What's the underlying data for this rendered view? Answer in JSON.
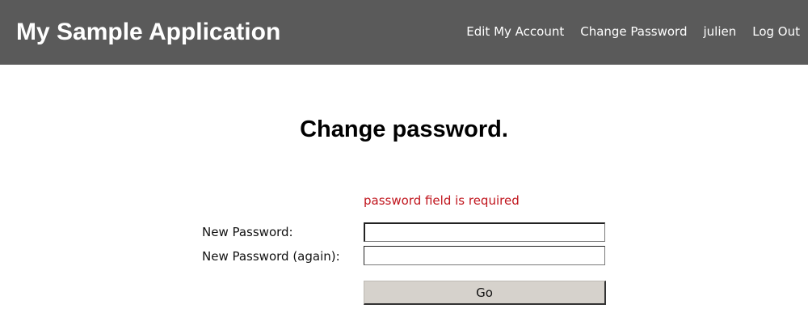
{
  "header": {
    "title": "My Sample Application",
    "nav": [
      "Edit My Account",
      "Change Password",
      "julien",
      "Log Out"
    ]
  },
  "main": {
    "title": "Change password.",
    "error": "password field is required",
    "fields": [
      {
        "label": "New Password:",
        "value": ""
      },
      {
        "label": "New Password (again):",
        "value": ""
      }
    ],
    "submit_label": "Go"
  },
  "colors": {
    "header_bg": "#5a5a5a",
    "error": "#c0141c",
    "button_bg": "#d6d2cc"
  }
}
